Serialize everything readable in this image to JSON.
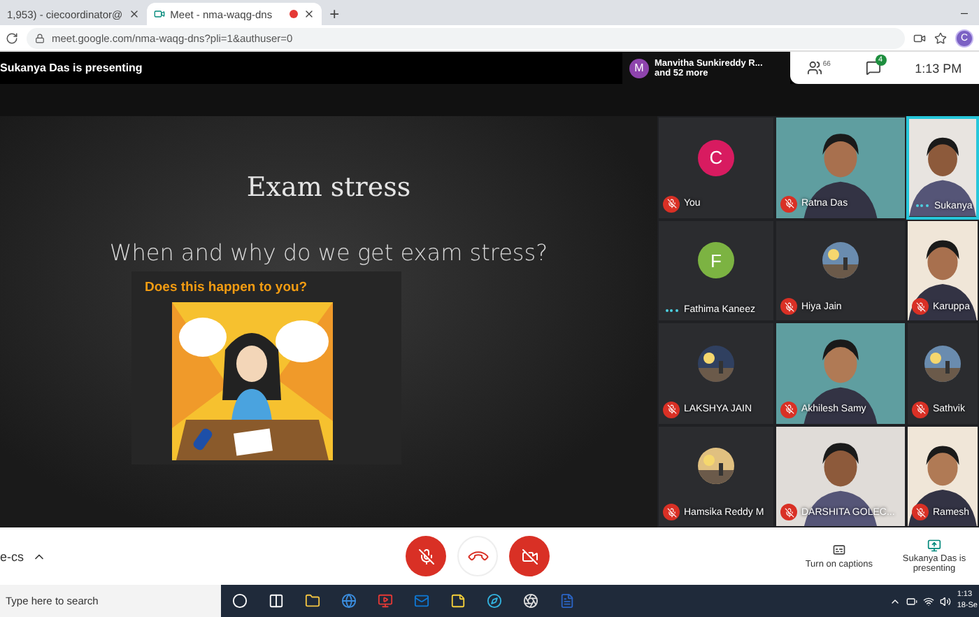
{
  "browser": {
    "tabs": [
      {
        "title": "1,953) - ciecoordinator@",
        "selected": false,
        "recording": false
      },
      {
        "title": "Meet - nma-waqg-dns",
        "selected": true,
        "recording": true
      }
    ],
    "new_tab": "+",
    "minimize": "–",
    "url": "meet.google.com/nma-waqg-dns?pli=1&authuser=0",
    "profile_initial": "C"
  },
  "meeting": {
    "presenter_banner": "Sukanya Das is presenting",
    "notification": {
      "initial": "M",
      "name": "Manvitha Sunkireddy R...",
      "more": "and 52 more"
    },
    "people_count": "66",
    "chat_badge": "4",
    "time": "1:13 PM"
  },
  "slide": {
    "title": "Exam stress",
    "question": "When and why do we get exam stress?",
    "caption": "Does this happen to you?"
  },
  "participants": [
    {
      "name": "You",
      "kind": "avatar",
      "initial": "C",
      "color": "#d81b60",
      "muted": true,
      "active_speaker": false
    },
    {
      "name": "Ratna Das",
      "kind": "video",
      "muted": true,
      "active_speaker": false
    },
    {
      "name": "Sukanya",
      "kind": "video",
      "muted": false,
      "active_speaker": true
    },
    {
      "name": "Fathima Kaneez",
      "kind": "avatar",
      "initial": "F",
      "color": "#7cb342",
      "muted": false,
      "active_speaker": false
    },
    {
      "name": "Hiya Jain",
      "muted": true,
      "active_speaker": false
    },
    {
      "name": "Karuppa",
      "kind": "video",
      "muted": true,
      "active_speaker": false
    },
    {
      "name": "LAKSHYA JAIN",
      "muted": true,
      "active_speaker": false
    },
    {
      "name": "Akhilesh Samy",
      "kind": "video",
      "muted": true,
      "active_speaker": false
    },
    {
      "name": "Sathvik",
      "muted": true,
      "active_speaker": false
    },
    {
      "name": "Hamsika Reddy M",
      "muted": true,
      "active_speaker": false
    },
    {
      "name": "DARSHITA GOLEC...",
      "kind": "video",
      "muted": true,
      "active_speaker": false
    },
    {
      "name": "Ramesh",
      "kind": "video",
      "muted": true,
      "active_speaker": false
    }
  ],
  "controls": {
    "meeting_code": "e-cs",
    "mic_on": false,
    "camera_on": false,
    "captions": "Turn on captions",
    "presenting": "Sukanya Das is presenting"
  },
  "taskbar": {
    "search_placeholder": "Type here to search",
    "time": "1:13",
    "date": "18-Se"
  }
}
